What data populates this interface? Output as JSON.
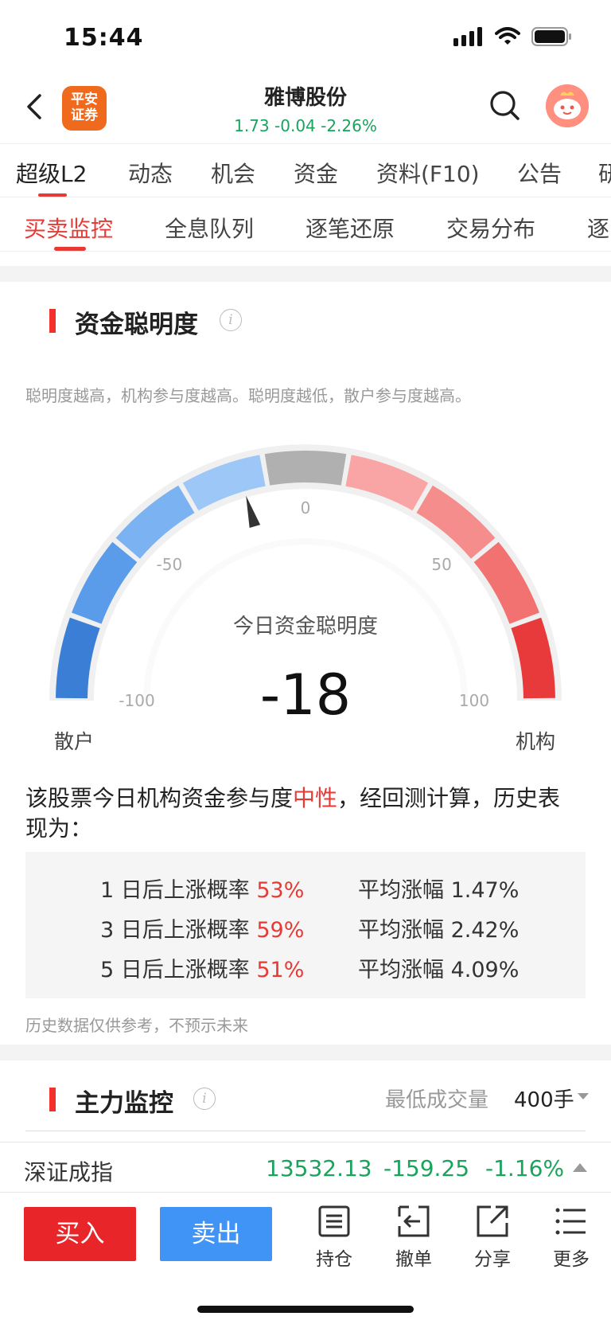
{
  "status_bar": {
    "time": "15:44"
  },
  "header": {
    "logo_text": "平安证券",
    "stock_name": "雅博股份",
    "quote": "1.73 -0.04 -2.26%"
  },
  "tabs_primary": [
    "超级L2",
    "动态",
    "机会",
    "资金",
    "资料(F10)",
    "公告",
    "研"
  ],
  "tabs_secondary": [
    "买卖监控",
    "全息队列",
    "逐笔还原",
    "交易分布",
    "逐"
  ],
  "smart_money": {
    "title": "资金聪明度",
    "description": "聪明度越高，机构参与度越高。聪明度越低，散户参与度越高。",
    "gauge": {
      "label": "今日资金聪明度",
      "value": -18,
      "value_text": "-18",
      "min": -100,
      "max": 100,
      "ticks": [
        "-100",
        "-50",
        "0",
        "50",
        "100"
      ],
      "left_label": "散户",
      "right_label": "机构",
      "segment_colors": [
        "#3a7ed6",
        "#5a9bea",
        "#7bb2f2",
        "#9cc7f7",
        "#b0b0b0",
        "#f9a5a5",
        "#f68d8d",
        "#f27272",
        "#e83a3a"
      ]
    },
    "summary_prefix": "该股票今日机构资金参与度",
    "summary_highlight": "中性",
    "summary_suffix": "，经回测计算，历史表现为：",
    "stats": [
      {
        "days": "1",
        "label": "日后上涨概率",
        "prob": "53%",
        "avg_label": "平均涨幅",
        "avg": "1.47%"
      },
      {
        "days": "3",
        "label": "日后上涨概率",
        "prob": "59%",
        "avg_label": "平均涨幅",
        "avg": "2.42%"
      },
      {
        "days": "5",
        "label": "日后上涨概率",
        "prob": "51%",
        "avg_label": "平均涨幅",
        "avg": "4.09%"
      }
    ],
    "footnote": "历史数据仅供参考，不预示未来"
  },
  "main_force": {
    "title": "主力监控",
    "min_volume_label": "最低成交量",
    "min_volume_value": "400手"
  },
  "index_bar": {
    "name": "深证成指",
    "value": "13532.13",
    "change": "-159.25",
    "change_pct": "-1.16%"
  },
  "bottom_bar": {
    "buy": "买入",
    "sell": "卖出",
    "tools": [
      {
        "icon": "holdings-icon",
        "label": "持仓"
      },
      {
        "icon": "cancel-order-icon",
        "label": "撤单"
      },
      {
        "icon": "share-icon",
        "label": "分享"
      },
      {
        "icon": "more-icon",
        "label": "更多"
      }
    ]
  },
  "colors": {
    "up": "#e83a35",
    "down": "#1aa35c",
    "buy": "#e8262a",
    "sell": "#3f94f5",
    "accent": "#f2312c"
  }
}
